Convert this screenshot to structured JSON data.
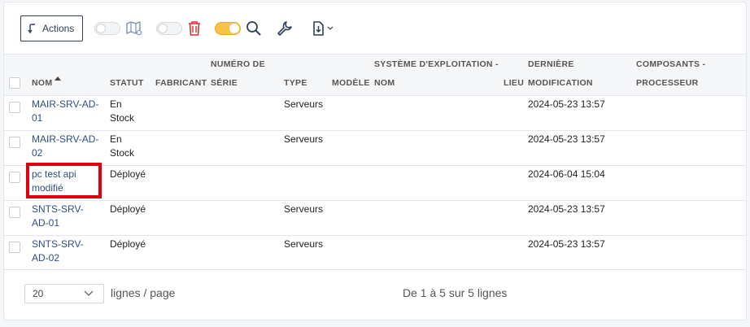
{
  "toolbar": {
    "actions_label": "Actions"
  },
  "table": {
    "headers": [
      {
        "key": "nom",
        "line1": "",
        "line2": "Nom",
        "sorted": "asc"
      },
      {
        "key": "statut",
        "line1": "",
        "line2": "Statut"
      },
      {
        "key": "fabricant",
        "line1": "",
        "line2": "Fabricant"
      },
      {
        "key": "numero",
        "line1": "Numéro de",
        "line2": "série"
      },
      {
        "key": "type",
        "line1": "",
        "line2": "Type"
      },
      {
        "key": "modele",
        "line1": "",
        "line2": "Modèle"
      },
      {
        "key": "os",
        "line1": "Système d'exploitation -",
        "line2": "Nom"
      },
      {
        "key": "lieu",
        "line1": "",
        "line2": "Lieu"
      },
      {
        "key": "modif",
        "line1": "Dernière",
        "line2": "modification"
      },
      {
        "key": "comp",
        "line1": "Composants -",
        "line2": "Processeur"
      }
    ],
    "rows": [
      {
        "nom": [
          "MAIR-SRV-AD-",
          "01"
        ],
        "statut": [
          "En",
          "Stock"
        ],
        "type": "Serveurs",
        "modif": "2024-05-23 13:57"
      },
      {
        "nom": [
          "MAIR-SRV-AD-",
          "02"
        ],
        "statut": [
          "En",
          "Stock"
        ],
        "type": "Serveurs",
        "modif": "2024-05-23 13:57"
      },
      {
        "nom": [
          "pc test api",
          "modifié"
        ],
        "statut": [
          "Déployé",
          ""
        ],
        "type": "",
        "modif": "2024-06-04 15:04"
      },
      {
        "nom": [
          "SNTS-SRV-",
          "AD-01"
        ],
        "statut": [
          "Déployé",
          ""
        ],
        "type": "Serveurs",
        "modif": "2024-05-23 13:57"
      },
      {
        "nom": [
          "SNTS-SRV-",
          "AD-02"
        ],
        "statut": [
          "Déployé",
          ""
        ],
        "type": "Serveurs",
        "modif": "2024-05-23 13:57"
      }
    ]
  },
  "footer": {
    "page_size": "20",
    "page_size_label": "lignes / page",
    "summary": "De 1 à 5 sur 5 lignes"
  },
  "colors": {
    "link": "#2e4e83",
    "highlight": "#e0000f",
    "toggle_on": "#f6c343",
    "trash": "#d9302c",
    "icon": "#2f3f5a"
  },
  "icons": [
    "undo-arrow-icon",
    "map-icon",
    "trash-icon",
    "search-icon",
    "wrench-icon",
    "export-icon",
    "chevron-down-icon",
    "sort-asc-icon"
  ]
}
